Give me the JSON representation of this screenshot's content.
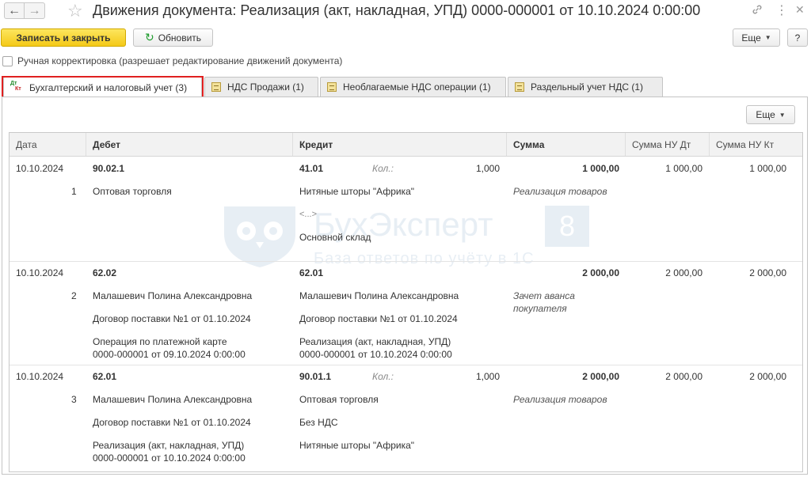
{
  "window": {
    "title": "Движения документа: Реализация (акт, накладная, УПД) 0000-000001 от 10.10.2024 0:00:00",
    "back_glyph": "←",
    "forward_glyph": "→",
    "link_glyph": "🔗",
    "menu_glyph": "⋮",
    "close_glyph": "✕"
  },
  "toolbar": {
    "save_close": "Записать и закрыть",
    "refresh": "Обновить",
    "more": "Еще",
    "help": "?"
  },
  "manual_edit": {
    "label": "Ручная корректировка (разрешает редактирование движений документа)",
    "checked": false
  },
  "tabs": [
    {
      "label": "Бухгалтерский и налоговый учет (3)",
      "active": true,
      "icon": "dt-kt-icon"
    },
    {
      "label": "НДС Продажи (1)",
      "active": false,
      "icon": "register-icon"
    },
    {
      "label": "Необлагаемые НДС операции (1)",
      "active": false,
      "icon": "register-icon"
    },
    {
      "label": "Раздельный учет НДС (1)",
      "active": false,
      "icon": "register-icon"
    }
  ],
  "tab_icon_text": {
    "dt": "Дт",
    "kt": "Кт"
  },
  "panel": {
    "more": "Еще"
  },
  "table": {
    "headers": {
      "date": "Дата",
      "debit": "Дебет",
      "credit": "Кредит",
      "sum": "Сумма",
      "sum_nu_dt": "Сумма НУ Дт",
      "sum_nu_kt": "Сумма НУ Кт"
    },
    "rows": [
      {
        "date": "10.10.2024",
        "num": "1",
        "debit_account": "90.02.1",
        "debit_lines": [
          "Оптовая торговля"
        ],
        "credit_account": "41.01",
        "qty_label": "Кол.:",
        "qty": "1,000",
        "credit_lines": [
          "Нитяные шторы \"Африка\"",
          "<...>",
          "Основной склад"
        ],
        "sum": "1 000,00",
        "content": "Реализация товаров",
        "sum_nu_dt": "1 000,00",
        "sum_nu_kt": "1 000,00"
      },
      {
        "date": "10.10.2024",
        "num": "2",
        "debit_account": "62.02",
        "debit_lines": [
          "Малашевич Полина Александровна",
          "Договор поставки №1 от 01.10.2024",
          "Операция по платежной карте",
          "0000-000001 от 09.10.2024 0:00:00"
        ],
        "credit_account": "62.01",
        "credit_lines": [
          "Малашевич Полина Александровна",
          "Договор поставки №1 от 01.10.2024",
          "Реализация (акт, накладная, УПД)",
          "0000-000001 от 10.10.2024 0:00:00"
        ],
        "sum": "2 000,00",
        "content_lines": [
          "Зачет аванса",
          "покупателя"
        ],
        "sum_nu_dt": "2 000,00",
        "sum_nu_kt": "2 000,00"
      },
      {
        "date": "10.10.2024",
        "num": "3",
        "debit_account": "62.01",
        "debit_lines": [
          "Малашевич Полина Александровна",
          "Договор поставки №1 от 01.10.2024",
          "Реализация (акт, накладная, УПД)",
          "0000-000001 от 10.10.2024 0:00:00"
        ],
        "credit_account": "90.01.1",
        "qty_label": "Кол.:",
        "qty": "1,000",
        "credit_lines": [
          "Оптовая торговля",
          "Без НДС",
          "Нитяные шторы \"Африка\""
        ],
        "sum": "2 000,00",
        "content": "Реализация товаров",
        "sum_nu_dt": "2 000,00",
        "sum_nu_kt": "2 000,00"
      }
    ]
  },
  "watermark": {
    "brand": "БухЭксперт",
    "badge": "8",
    "tagline": "База ответов по учёту в 1С"
  },
  "colors": {
    "primary_button": "#f4c918",
    "highlight_border": "#e02020",
    "refresh_icon": "#1c9b2b"
  }
}
